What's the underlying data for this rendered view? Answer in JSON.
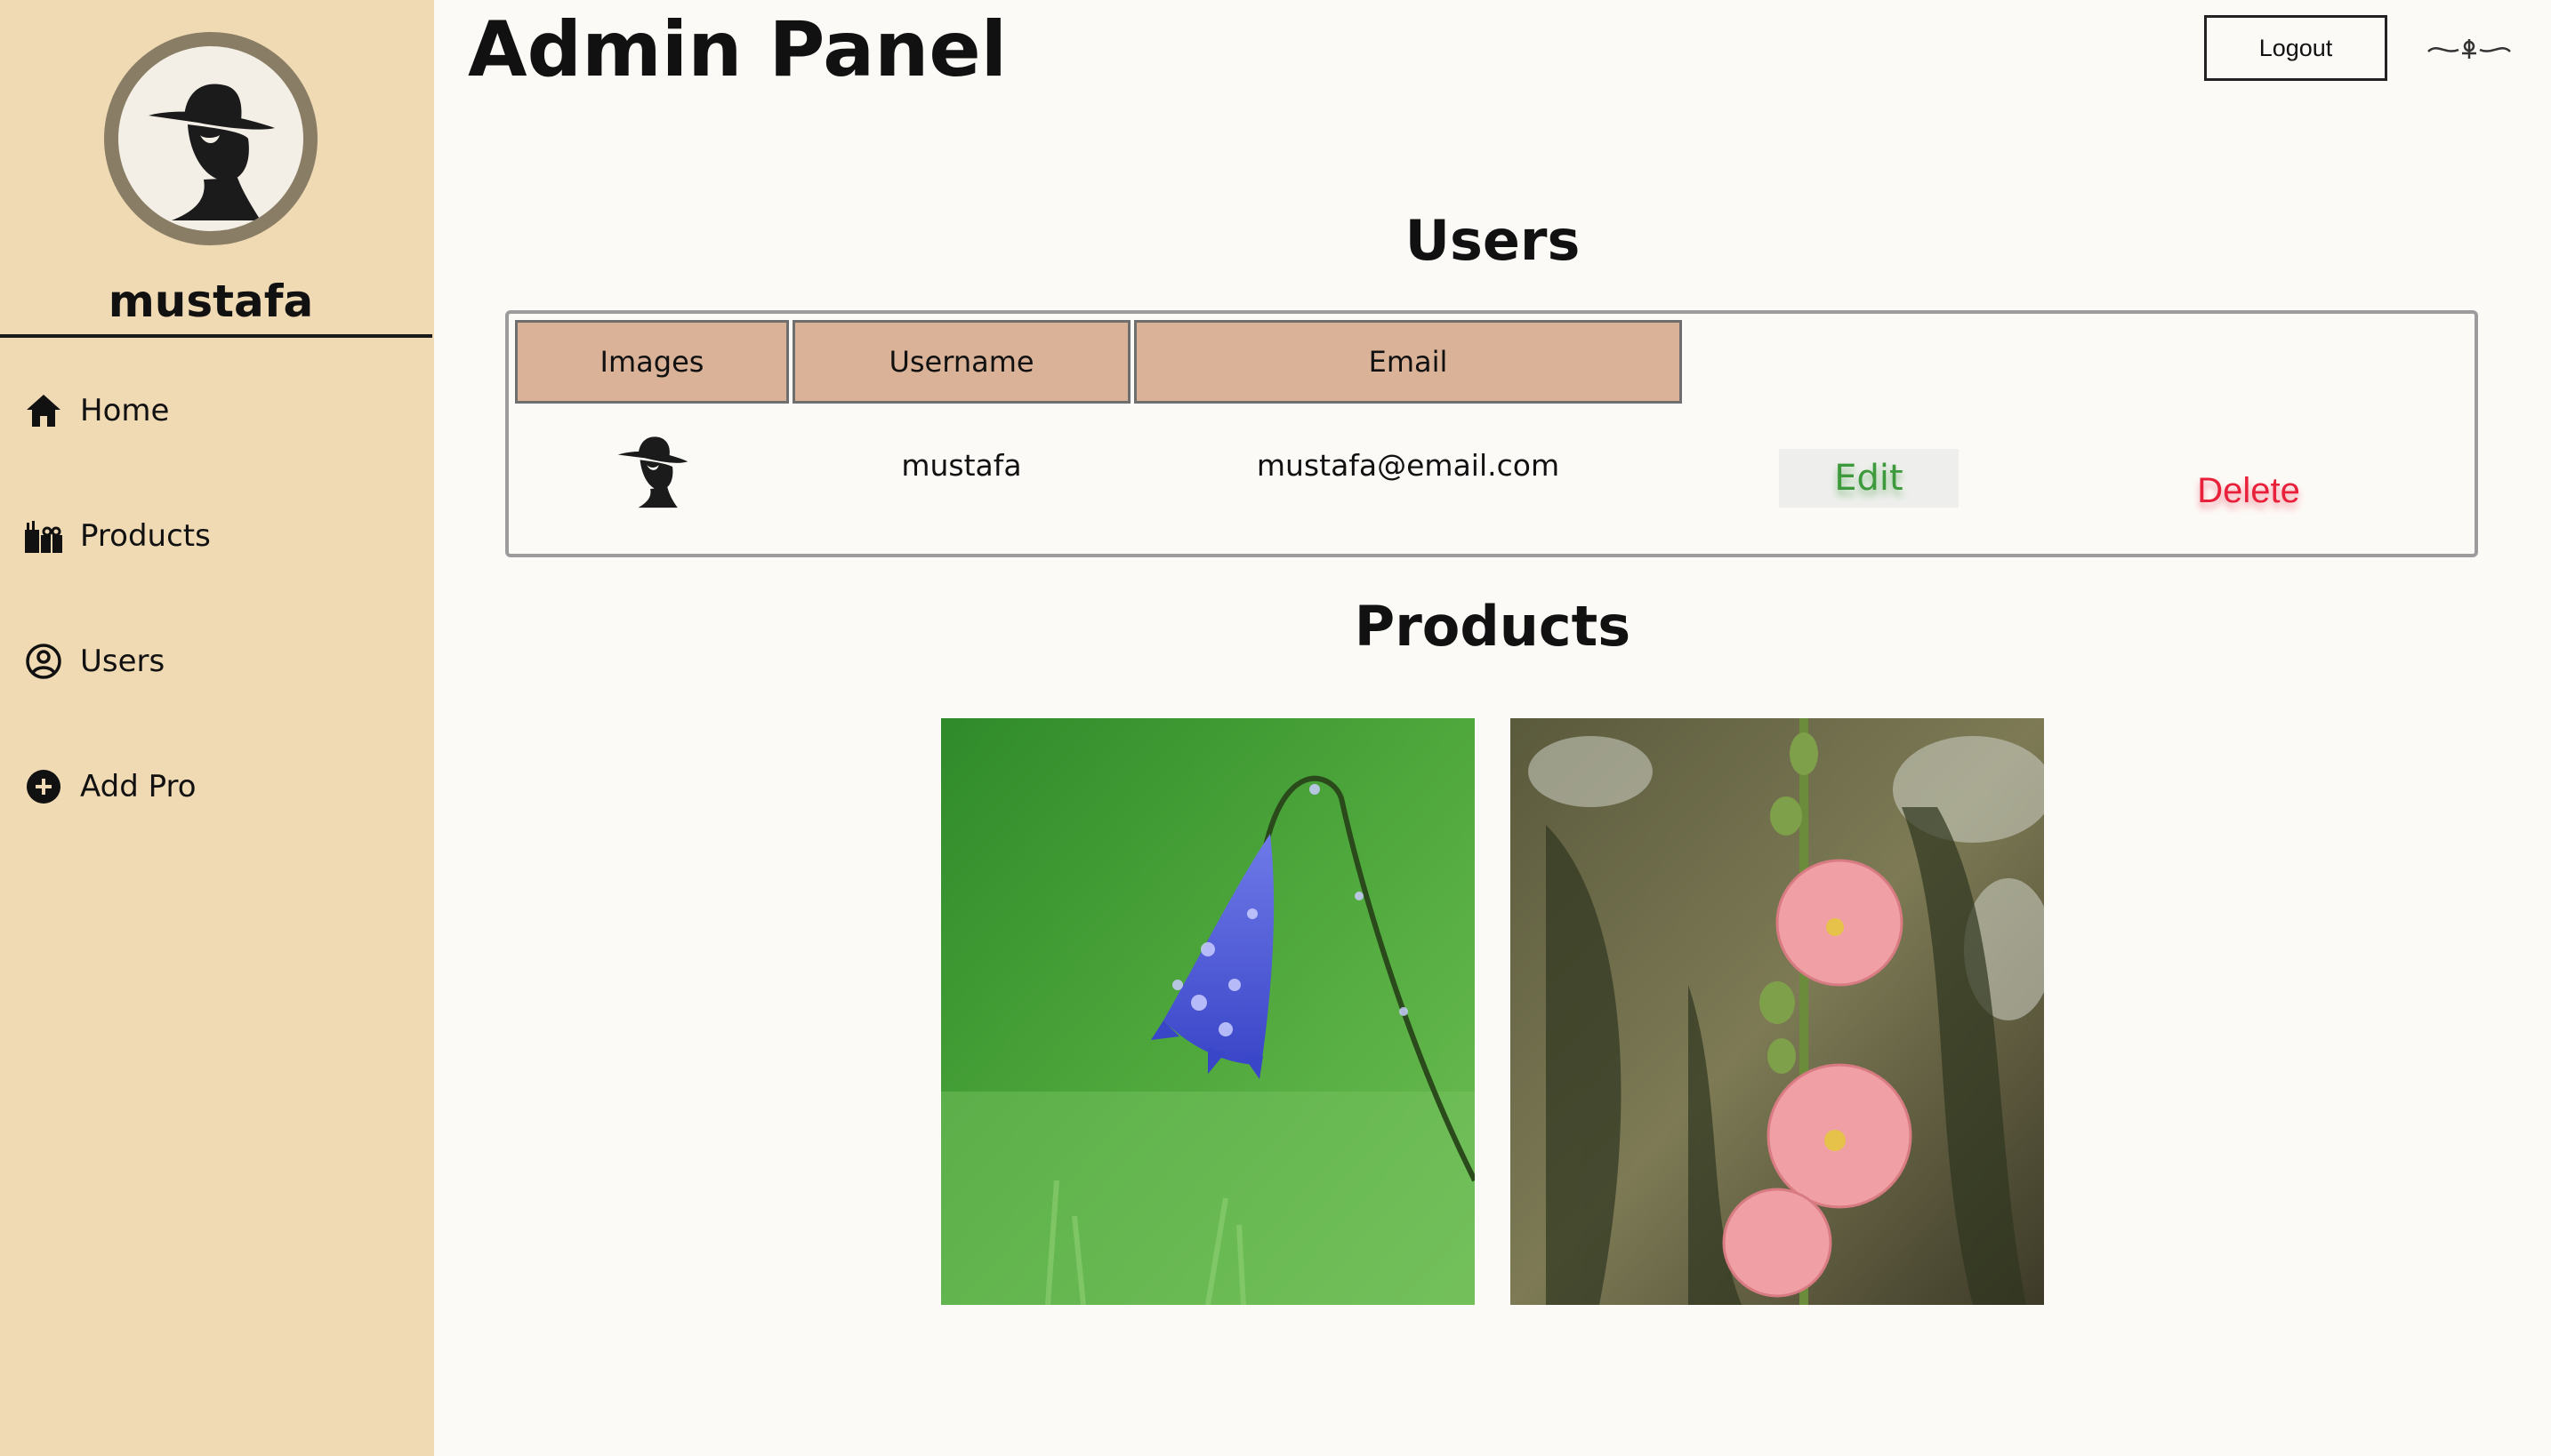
{
  "sidebar": {
    "profile_name": "mustafa",
    "avatar_icon": "cowboy-bandit-avatar",
    "items": [
      {
        "label": "Home",
        "icon": "home-icon"
      },
      {
        "label": "Products",
        "icon": "gifts-icon"
      },
      {
        "label": "Users",
        "icon": "user-circle-icon"
      },
      {
        "label": "Add Pro",
        "icon": "plus-circle-icon"
      }
    ]
  },
  "header": {
    "title": "Admin Panel",
    "logout_label": "Logout",
    "ornament_icon": "decorative-flourish-icon"
  },
  "users": {
    "title": "Users",
    "columns": [
      "Images",
      "Username",
      "Email"
    ],
    "rows": [
      {
        "image_icon": "cowboy-bandit-avatar",
        "username": "mustafa",
        "email": "mustafa@email.com",
        "edit_label": "Edit",
        "delete_label": "Delete"
      }
    ]
  },
  "products": {
    "title": "Products",
    "items": [
      {
        "image": "blue-bellflower-with-raindrops"
      },
      {
        "image": "pink-hollyhock-flowers"
      }
    ]
  },
  "colors": {
    "sidebar_bg": "#f0dab4",
    "page_bg": "#fcfaf6",
    "table_header_bg": "#d9b298",
    "edit_text": "#3c9a3c",
    "delete_text": "#e8203a"
  }
}
